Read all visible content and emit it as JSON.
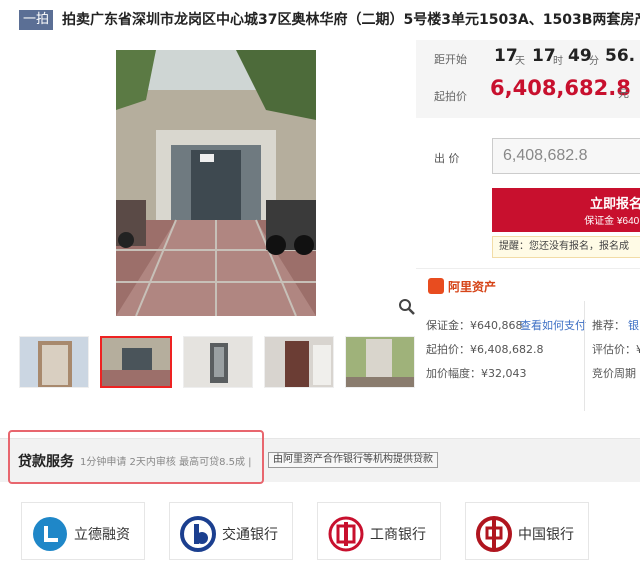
{
  "header": {
    "round_tag": "一拍",
    "title": "拍卖广东省深圳市龙岗区中心城37区奥林华府（二期）5号楼3单元1503A、1503B两套房产"
  },
  "countdown": {
    "label": "距开始",
    "days": "17",
    "days_unit": "天",
    "hours": "17",
    "hours_unit": "时",
    "minutes": "49",
    "minutes_unit": "分",
    "seconds": "56."
  },
  "start_price": {
    "label": "起拍价",
    "value": "6,408,682.8",
    "unit": "元"
  },
  "bid": {
    "label": "出 价",
    "value": "6,408,682.8"
  },
  "signup": {
    "label": "立即报名",
    "deposit": "保证金 ¥640,"
  },
  "reminder": "提醒：您还没有报名，报名成",
  "info": {
    "brand": "阿里资产",
    "deposit_label": "保证金：¥640,868",
    "deposit_link": "查看如何支付",
    "recommend_label": "推荐：",
    "recommend_link": "银",
    "start_price_line": "起拍价：¥6,408,682.8",
    "eval_line": "评估价：¥",
    "increment_line": "加价幅度：¥32,043",
    "cycle_line": "竞价周期"
  },
  "loan": {
    "title": "贷款服务",
    "desc": "1分钟申请 2天内审核 最高可贷8.5成 |",
    "tag": "由阿里资产合作银行等机构提供贷款"
  },
  "banks": [
    {
      "name": "立德融资",
      "color": "#1f87c8"
    },
    {
      "name": "交通银行",
      "color": "#1b3f8f"
    },
    {
      "name": "工商银行",
      "color": "#c8102e"
    },
    {
      "name": "中国银行",
      "color": "#b0151f"
    }
  ]
}
